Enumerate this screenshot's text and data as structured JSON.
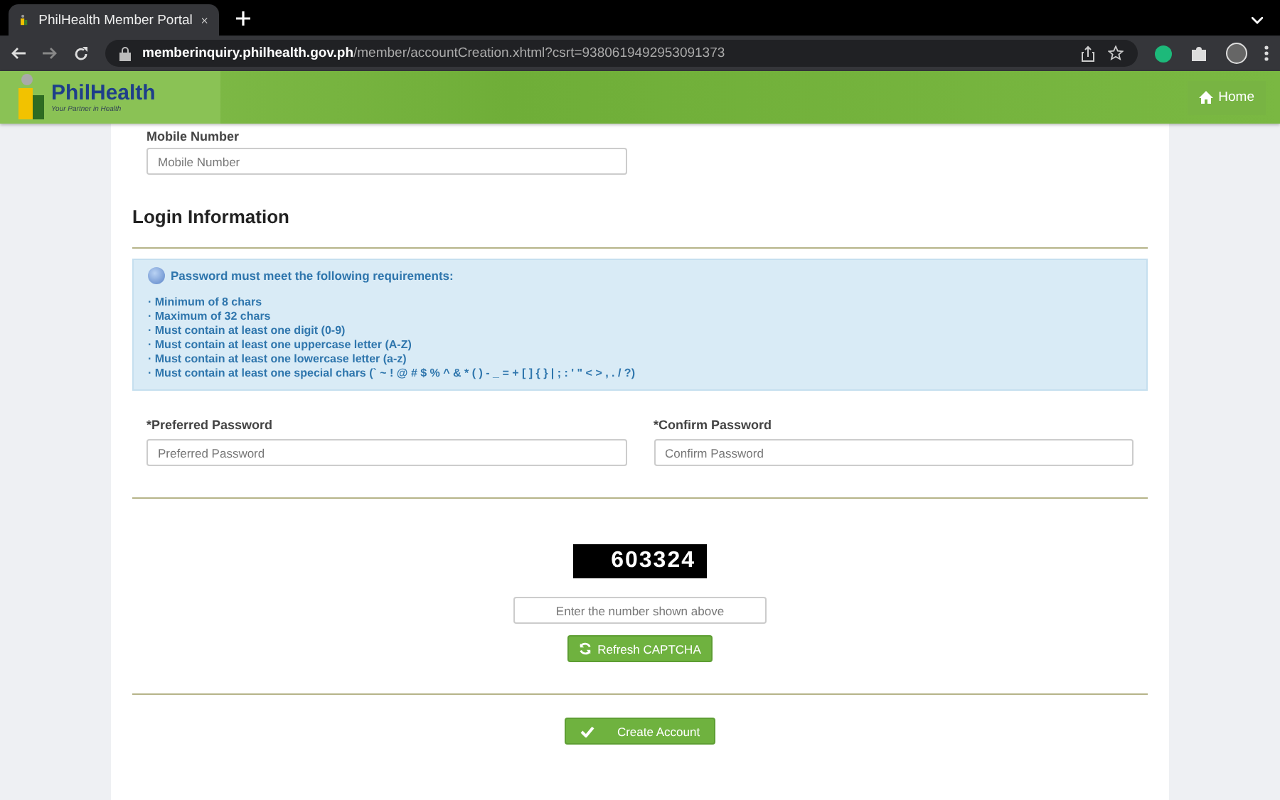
{
  "browser": {
    "tab_title": "PhilHealth Member Portal",
    "url_host": "memberinquiry.philhealth.gov.ph",
    "url_path": "/member/accountCreation.xhtml?csrt=9380619492953091373"
  },
  "header": {
    "logo_text": "PhilHealth",
    "tagline": "Your Partner in Health",
    "home_button": "Home"
  },
  "mobile": {
    "label": "Mobile Number",
    "placeholder": "Mobile Number"
  },
  "section_title": "Login Information",
  "requirements": {
    "title": "Password must meet the following requirements:",
    "items": [
      "· Minimum of 8 chars",
      "· Maximum of 32 chars",
      "· Must contain at least one digit (0-9)",
      "· Must contain at least one uppercase letter (A-Z)",
      "· Must contain at least one lowercase letter (a-z)",
      "· Must contain at least one special chars (` ~ ! @ # $ % ^ & * ( ) - _ = + [ ] { } | ; : ' \" < > , . / ?)"
    ]
  },
  "password_fields": [
    {
      "label": "*Preferred Password",
      "placeholder": "Preferred Password"
    },
    {
      "label": "*Confirm Password",
      "placeholder": "Confirm Password"
    }
  ],
  "captcha": {
    "code": "603324",
    "placeholder": "Enter the number shown above",
    "refresh_button": "Refresh CAPTCHA"
  },
  "submit_button": "Create Account"
}
